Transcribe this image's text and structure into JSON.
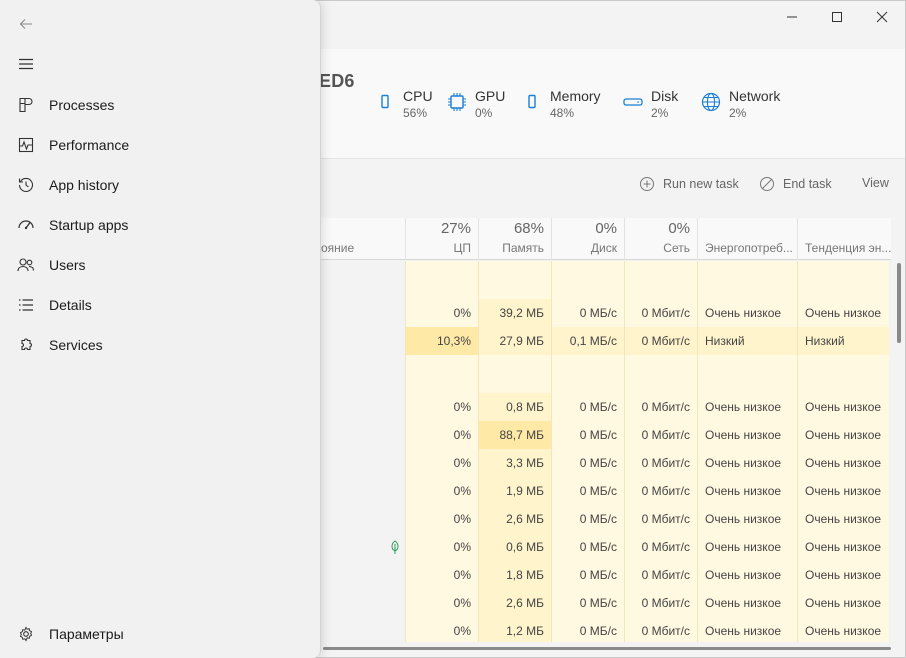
{
  "window": {
    "machine_name_suffix": "ED6",
    "controls": {
      "minimize": "minimize-icon",
      "maximize": "maximize-icon",
      "close": "close-icon"
    }
  },
  "metrics": [
    {
      "label": "CPU",
      "value": "56%",
      "icon": "cpu-icon"
    },
    {
      "label": "GPU",
      "value": "0%",
      "icon": "gpu-chip-icon"
    },
    {
      "label": "Memory",
      "value": "48%",
      "icon": "memory-icon"
    },
    {
      "label": "Disk",
      "value": "2%",
      "icon": "disk-icon"
    },
    {
      "label": "Network",
      "value": "2%",
      "icon": "network-globe-icon"
    }
  ],
  "toolbar": {
    "run_new_task": "Run new task",
    "end_task": "End task",
    "view": "View"
  },
  "columns": {
    "status_partial": "ояние",
    "cpu": {
      "pct": "27%",
      "name": "ЦП"
    },
    "memory": {
      "pct": "68%",
      "name": "Память"
    },
    "disk": {
      "pct": "0%",
      "name": "Диск"
    },
    "network": {
      "pct": "0%",
      "name": "Сеть"
    },
    "energy": {
      "name": "Энергопотреб..."
    },
    "trend": {
      "name": "Тенденция эн..."
    }
  },
  "rows": [
    {
      "cpu": "",
      "mem": "",
      "disk": "",
      "net": "",
      "energy": "",
      "trend": ""
    },
    {
      "cpu": "0%",
      "mem": "39,2 МБ",
      "disk": "0 МБ/с",
      "net": "0 Мбит/с",
      "energy": "Очень низкое",
      "trend": "Очень низкое"
    },
    {
      "cpu": "10,3%",
      "mem": "27,9 МБ",
      "disk": "0,1 МБ/с",
      "net": "0 Мбит/с",
      "energy": "Низкий",
      "trend": "Низкий"
    },
    {
      "cpu": "",
      "mem": "",
      "disk": "",
      "net": "",
      "energy": "",
      "trend": ""
    },
    {
      "cpu": "0%",
      "mem": "0,8 МБ",
      "disk": "0 МБ/с",
      "net": "0 Мбит/с",
      "energy": "Очень низкое",
      "trend": "Очень низкое"
    },
    {
      "cpu": "0%",
      "mem": "88,7 МБ",
      "disk": "0 МБ/с",
      "net": "0 Мбит/с",
      "energy": "Очень низкое",
      "trend": "Очень низкое"
    },
    {
      "cpu": "0%",
      "mem": "3,3 МБ",
      "disk": "0 МБ/с",
      "net": "0 Мбит/с",
      "energy": "Очень низкое",
      "trend": "Очень низкое"
    },
    {
      "cpu": "0%",
      "mem": "1,9 МБ",
      "disk": "0 МБ/с",
      "net": "0 Мбит/с",
      "energy": "Очень низкое",
      "trend": "Очень низкое"
    },
    {
      "cpu": "0%",
      "mem": "2,6 МБ",
      "disk": "0 МБ/с",
      "net": "0 Мбит/с",
      "energy": "Очень низкое",
      "trend": "Очень низкое"
    },
    {
      "cpu": "0%",
      "mem": "0,6 МБ",
      "disk": "0 МБ/с",
      "net": "0 Мбит/с",
      "energy": "Очень низкое",
      "trend": "Очень низкое"
    },
    {
      "cpu": "0%",
      "mem": "1,8 МБ",
      "disk": "0 МБ/с",
      "net": "0 Мбит/с",
      "energy": "Очень низкое",
      "trend": "Очень низкое"
    },
    {
      "cpu": "0%",
      "mem": "2,6 МБ",
      "disk": "0 МБ/с",
      "net": "0 Мбит/с",
      "energy": "Очень низкое",
      "trend": "Очень низкое"
    },
    {
      "cpu": "0%",
      "mem": "1,2 МБ",
      "disk": "0 МБ/с",
      "net": "0 Мбит/с",
      "energy": "Очень низкое",
      "trend": "Очень низкое"
    }
  ],
  "nav": {
    "back_icon": "back-arrow-icon",
    "menu_icon": "hamburger-menu-icon",
    "items": [
      {
        "label": "Processes",
        "icon": "processes-icon"
      },
      {
        "label": "Performance",
        "icon": "performance-icon"
      },
      {
        "label": "App history",
        "icon": "history-icon"
      },
      {
        "label": "Startup apps",
        "icon": "speedometer-icon"
      },
      {
        "label": "Users",
        "icon": "users-icon"
      },
      {
        "label": "Details",
        "icon": "details-list-icon"
      },
      {
        "label": "Services",
        "icon": "services-puzzle-icon"
      }
    ],
    "settings": {
      "label": "Параметры",
      "icon": "gear-icon"
    }
  }
}
